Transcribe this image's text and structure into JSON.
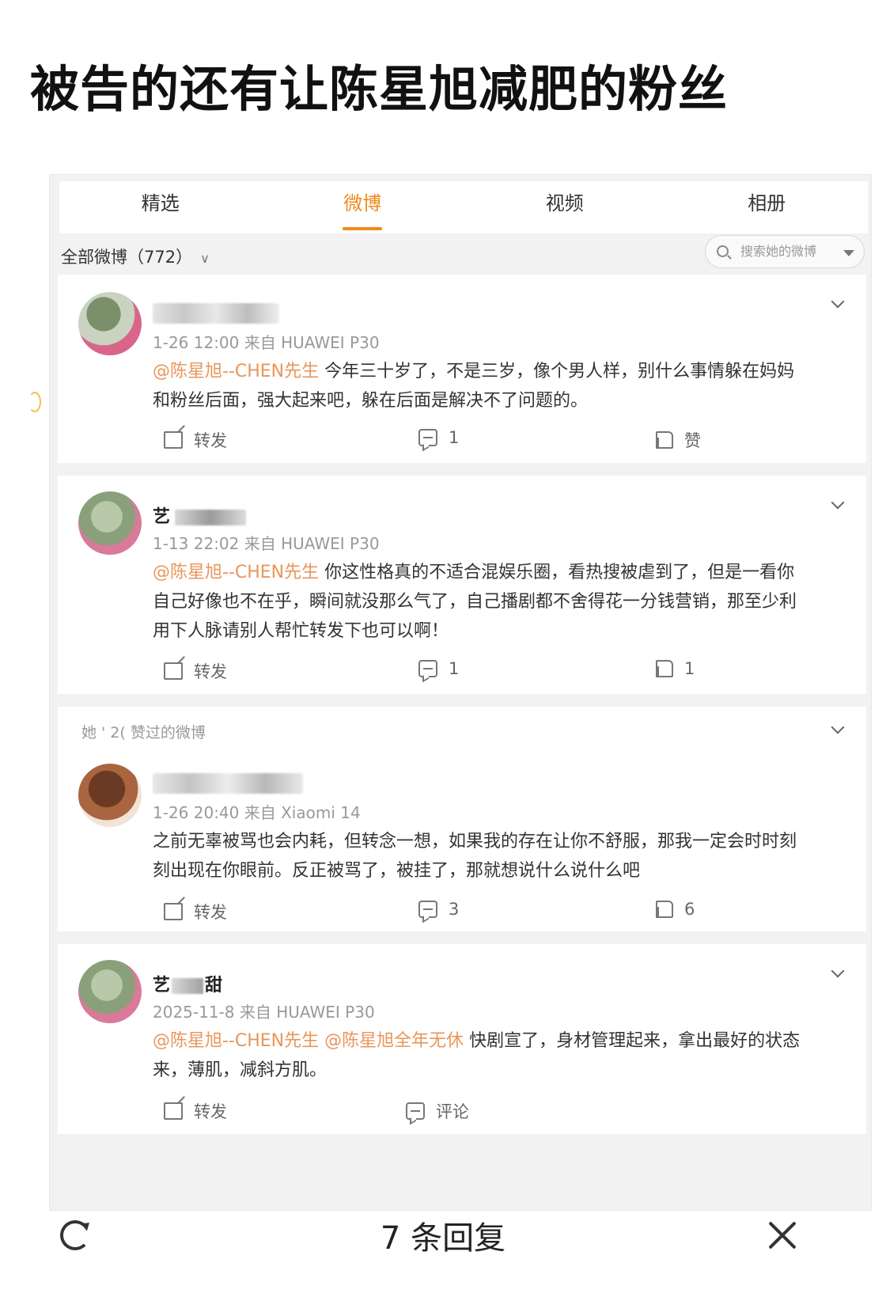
{
  "headline": "被告的还有让陈星旭减肥的粉丝",
  "tabs": [
    "精选",
    "微博",
    "视频",
    "相册"
  ],
  "active_tab": "微博",
  "filter_label": "全部微博（772）",
  "search_placeholder": "搜索她的微博",
  "liked_section_label": "她 ' 2( 赞过的微博",
  "posts": [
    {
      "user": "",
      "meta": "1-26 12:00 来自 HUAWEI P30",
      "mentions": [
        "@陈星旭--CHEN先生"
      ],
      "text": "今年三十岁了，不是三岁，像个男人样，别什么事情躲在妈妈和粉丝后面，强大起来吧，躲在后面是解决不了问题的。",
      "repost": "转发",
      "comments": "1",
      "likes": "赞"
    },
    {
      "user": "艺",
      "meta": "1-13 22:02 来自 HUAWEI P30",
      "mentions": [
        "@陈星旭--CHEN先生"
      ],
      "text": "你这性格真的不适合混娱乐圈，看热搜被虐到了，但是一看你自己好像也不在乎，瞬间就没那么气了，自己播剧都不舍得花一分钱营销，那至少利用下人脉请别人帮忙转发下也可以啊！",
      "repost": "转发",
      "comments": "1",
      "likes": "1"
    },
    {
      "user": "",
      "meta": "1-26 20:40 来自 Xiaomi 14",
      "mentions": [],
      "text": "之前无辜被骂也会内耗，但转念一想，如果我的存在让你不舒服，那我一定会时时刻刻出现在你眼前。反正被骂了，被挂了，那就想说什么说什么吧",
      "repost": "转发",
      "comments": "3",
      "likes": "6"
    },
    {
      "user": "艺",
      "user_suffix": "甜",
      "meta": "2025-11-8 来自 HUAWEI P30",
      "mentions": [
        "@陈星旭--CHEN先生",
        "@陈星旭全年无休"
      ],
      "text": "快剧宣了，身材管理起来，拿出最好的状态来，薄肌，减斜方肌。",
      "repost": "转发",
      "comments": "评论"
    }
  ],
  "bottom_bar": {
    "reply_count": "7 条回复"
  },
  "colors": {
    "accent": "#f08a1c",
    "mention": "#e8965a"
  },
  "icons": [
    "share-icon",
    "comment-icon",
    "like-icon",
    "chevron-down-icon",
    "search-icon",
    "refresh-icon",
    "close-icon"
  ]
}
